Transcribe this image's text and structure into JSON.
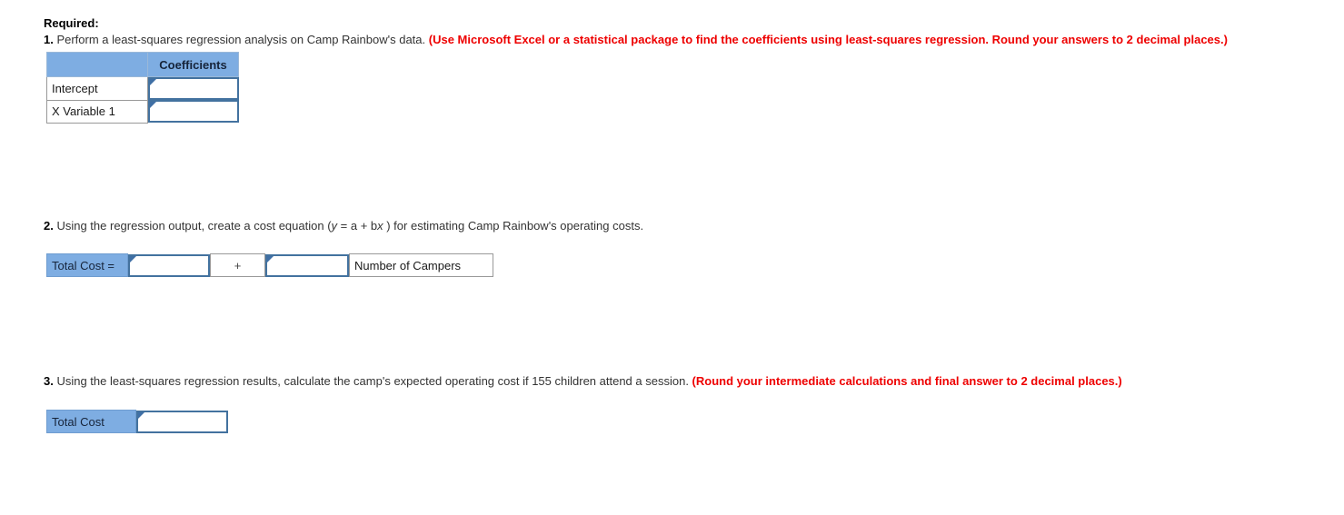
{
  "document": {
    "heading": "Required:",
    "questions": [
      {
        "number": "1.",
        "text_before": " Perform a least-squares regression analysis on Camp Rainbow's data. ",
        "red_note": "(Use Microsoft Excel or a statistical package to find the coefficients using least-squares regression. Round your answers to 2 decimal places.)"
      },
      {
        "number": "2.",
        "text_part1": " Using the regression output, create a cost equation (",
        "eq_y": "y",
        "eq_mid": " = a + b",
        "eq_x": "x",
        "text_part2": " ) for estimating Camp Rainbow's operating costs."
      },
      {
        "number": "3.",
        "text_before": " Using the least-squares regression results, calculate the camp's expected operating cost if 155 children attend a session. ",
        "red_note": "(Round your intermediate calculations and final answer to 2 decimal places.)"
      }
    ]
  },
  "regression_table": {
    "header_blank": "",
    "header_coefficients": "Coefficients",
    "rows": [
      {
        "label": "Intercept",
        "value": ""
      },
      {
        "label": "X Variable 1",
        "value": ""
      }
    ]
  },
  "cost_equation_table": {
    "label": "Total Cost =",
    "intercept_value": "",
    "operator": "+",
    "slope_value": "",
    "variable_label": "Number of Campers"
  },
  "total_cost_table": {
    "label": "Total Cost",
    "value": ""
  },
  "colors": {
    "header_blue": "#7eade2",
    "input_border": "#43729f",
    "red_note": "#ee0000",
    "grid_border": "#999999"
  }
}
